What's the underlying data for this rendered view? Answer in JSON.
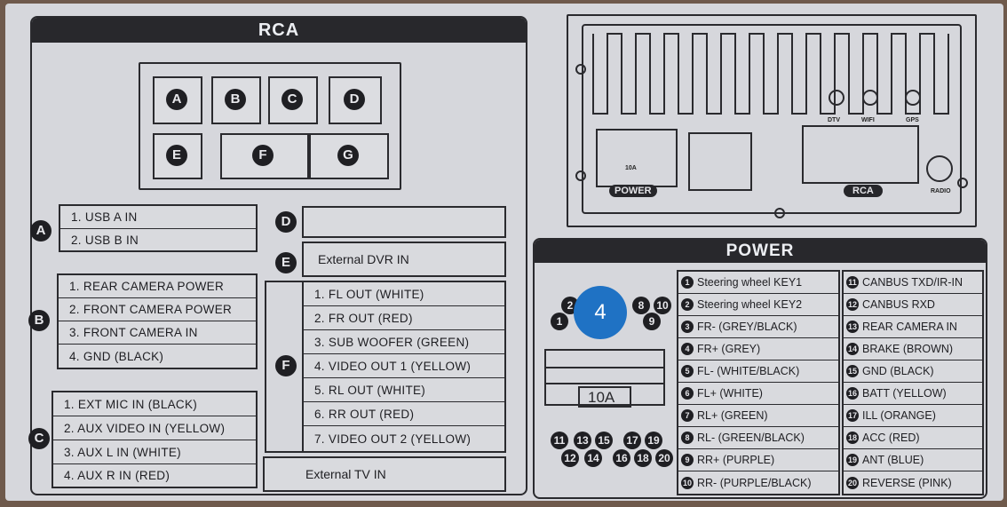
{
  "rca": {
    "title": "RCA",
    "ports": [
      "A",
      "B",
      "C",
      "D",
      "E",
      "F",
      "G"
    ],
    "a": {
      "badge": "A",
      "rows": [
        "1. USB A IN",
        "2. USB B IN"
      ]
    },
    "b": {
      "badge": "B",
      "rows": [
        "1. REAR CAMERA POWER",
        "2. FRONT CAMERA POWER",
        "3. FRONT CAMERA IN",
        "4. GND (BLACK)"
      ]
    },
    "c": {
      "badge": "C",
      "rows": [
        "1. EXT MIC IN (BLACK)",
        "2. AUX VIDEO IN (YELLOW)",
        "3. AUX L IN (WHITE)",
        "4. AUX R IN (RED)"
      ]
    },
    "d": {
      "badge": "D",
      "text": ""
    },
    "e": {
      "badge": "E",
      "text": "External DVR IN"
    },
    "f": {
      "badge": "F",
      "rows": [
        "1. FL OUT (WHITE)",
        "2. FR OUT (RED)",
        "3. SUB WOOFER (GREEN)",
        "4. VIDEO OUT 1 (YELLOW)",
        "5. RL OUT (WHITE)",
        "6. RR OUT (RED)",
        "7. VIDEO OUT 2 (YELLOW)"
      ]
    },
    "g": {
      "badge": "G",
      "text": "External TV IN"
    }
  },
  "unit": {
    "fuse": "10A",
    "power_label": "POWER",
    "rca_label": "RCA",
    "dtv": "DTV",
    "wifi": "WIFI",
    "gps": "GPS",
    "radio": "RADIO"
  },
  "power": {
    "title": "POWER",
    "connector_fuse": "10A",
    "pins_top": [
      "2",
      "1",
      "8",
      "9",
      "10"
    ],
    "pins_bottom": [
      "11",
      "12",
      "13",
      "14",
      "15",
      "16",
      "17",
      "18",
      "19",
      "20"
    ],
    "left": [
      {
        "n": "1",
        "label": "Steering wheel KEY1"
      },
      {
        "n": "2",
        "label": "Steering wheel KEY2"
      },
      {
        "n": "3",
        "label": "FR- (GREY/BLACK)"
      },
      {
        "n": "4",
        "label": "FR+ (GREY)"
      },
      {
        "n": "5",
        "label": "FL- (WHITE/BLACK)"
      },
      {
        "n": "6",
        "label": "FL+ (WHITE)"
      },
      {
        "n": "7",
        "label": "RL+ (GREEN)"
      },
      {
        "n": "8",
        "label": "RL- (GREEN/BLACK)"
      },
      {
        "n": "9",
        "label": "RR+ (PURPLE)"
      },
      {
        "n": "10",
        "label": "RR- (PURPLE/BLACK)"
      }
    ],
    "right": [
      {
        "n": "11",
        "label": "CANBUS TXD/IR-IN"
      },
      {
        "n": "12",
        "label": "CANBUS RXD"
      },
      {
        "n": "13",
        "label": "REAR CAMERA IN"
      },
      {
        "n": "14",
        "label": "BRAKE (BROWN)"
      },
      {
        "n": "15",
        "label": "GND (BLACK)"
      },
      {
        "n": "16",
        "label": "BATT (YELLOW)"
      },
      {
        "n": "17",
        "label": "ILL (ORANGE)"
      },
      {
        "n": "18",
        "label": "ACC (RED)"
      },
      {
        "n": "19",
        "label": "ANT (BLUE)"
      },
      {
        "n": "20",
        "label": "REVERSE (PINK)"
      }
    ]
  },
  "marker": "4",
  "colors": {
    "ink": "#2a2a2e",
    "paper": "#d6d7dc",
    "marker": "#1f72c4"
  }
}
